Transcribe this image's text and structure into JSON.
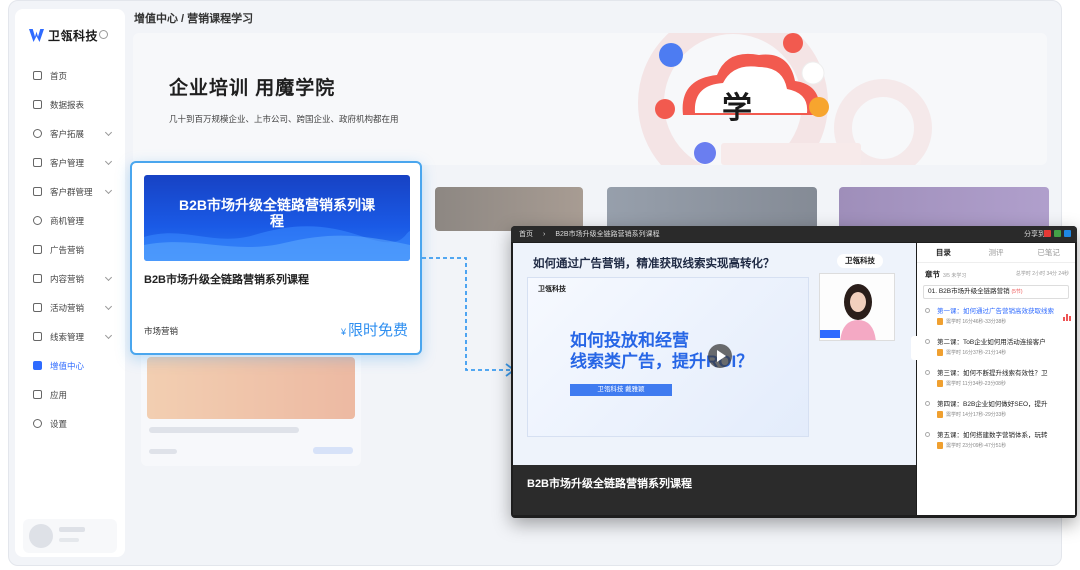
{
  "sidebar": {
    "brand": "卫瓴科技",
    "items": [
      {
        "label": "首页",
        "icon": "home-icon",
        "chevron": false,
        "active": false
      },
      {
        "label": "数据报表",
        "icon": "report-icon",
        "chevron": false,
        "active": false
      },
      {
        "label": "客户拓展",
        "icon": "search-user-icon",
        "chevron": true,
        "active": false
      },
      {
        "label": "客户管理",
        "icon": "customer-icon",
        "chevron": true,
        "active": false
      },
      {
        "label": "客户群管理",
        "icon": "group-icon",
        "chevron": true,
        "active": false
      },
      {
        "label": "商机管理",
        "icon": "opportunity-icon",
        "chevron": false,
        "active": false
      },
      {
        "label": "广告营销",
        "icon": "ad-icon",
        "chevron": false,
        "active": false
      },
      {
        "label": "内容营销",
        "icon": "content-icon",
        "chevron": true,
        "active": false
      },
      {
        "label": "活动营销",
        "icon": "event-icon",
        "chevron": true,
        "active": false
      },
      {
        "label": "线索管理",
        "icon": "lead-icon",
        "chevron": true,
        "active": false
      },
      {
        "label": "增值中心",
        "icon": "value-center-icon",
        "chevron": false,
        "active": true
      },
      {
        "label": "应用",
        "icon": "apps-icon",
        "chevron": false,
        "active": false
      },
      {
        "label": "设置",
        "icon": "settings-icon",
        "chevron": false,
        "active": false
      }
    ]
  },
  "breadcrumb": {
    "parent": "增值中心",
    "separator": " / ",
    "current": "营销课程学习"
  },
  "hero": {
    "title": "企业培训 用魔学院",
    "subtitle": "几十到百万规模企业、上市公司、跨国企业、政府机构都在用",
    "art_char": "学"
  },
  "course_card": {
    "cover_title": "B2B市场升级全链路营销系列课程",
    "title": "B2B市场升级全链路营销系列课程",
    "tag": "市场营销",
    "currency": "¥",
    "price": "限时免费"
  },
  "player": {
    "topbar": {
      "home": "首页",
      "separator": "›",
      "course": "B2B市场升级全链路营销系列课程",
      "share_label": "分享到:"
    },
    "question": "如何通过广告营销，精准获取线索实现高转化？",
    "brand_tag": "卫瓴科技",
    "slide": {
      "logo": "卫瓴科技",
      "headline_line1": "如何投放和经营",
      "headline_line2": "线索类广告，提升ROI？",
      "caption": "卫瓴科技 戴雅颖"
    },
    "course_title": "B2B市场升级全链路营销系列课程",
    "colors": {
      "accent": "#2f6bff",
      "price": "#2f8ff0",
      "highlight_border": "#4aa6ee"
    }
  },
  "panel": {
    "tabs": [
      {
        "label": "目录",
        "active": true
      },
      {
        "label": "测评",
        "active": false
      },
      {
        "label": "已笔记",
        "active": false
      }
    ],
    "chapter_label": "章节",
    "chapter_progress": "3/5 未学习",
    "total_time": "总学时 2小时 34分 24秒",
    "chapter_select": "01. B2B市场升级全链路营销",
    "chapter_count": "(5节)",
    "lessons": [
      {
        "title": "第一课：如何通过广告营销高效获取线索",
        "meta": "需学时 16分46秒-33分38秒",
        "playing": true
      },
      {
        "title": "第二课：ToB企业如何用活动连接客户",
        "meta": "需学时 16分37秒-21分14秒",
        "playing": false
      },
      {
        "title": "第三课：如何不断提升线索有效性？卫",
        "meta": "需学时 11分34秒-23分08秒",
        "playing": false
      },
      {
        "title": "第四课：B2B企业如何做好SEO，提升",
        "meta": "需学时 14分17秒-29分33秒",
        "playing": false
      },
      {
        "title": "第五课：如何搭建数字营销体系，玩转",
        "meta": "需学时 23分09秒-47分51秒",
        "playing": false
      }
    ]
  }
}
